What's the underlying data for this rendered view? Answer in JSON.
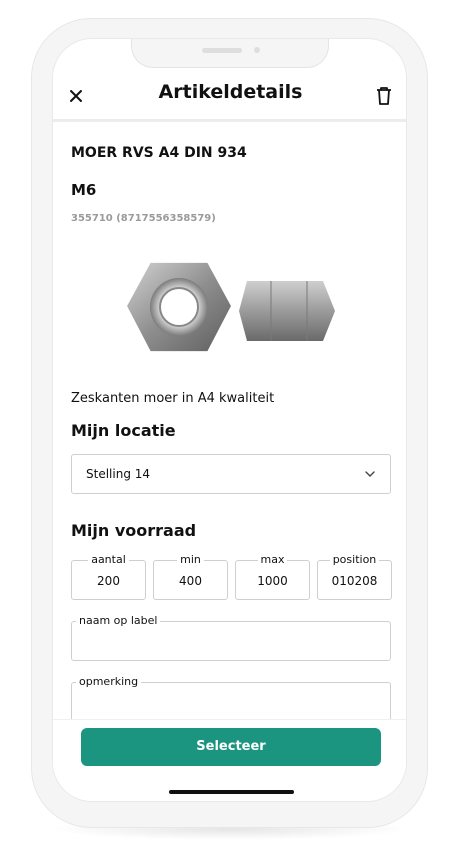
{
  "header": {
    "title": "Artikeldetails"
  },
  "product": {
    "name": "MOER RVS A4 DIN 934",
    "size": "M6",
    "code": "355710 (8717556358579)",
    "description": "Zeskanten moer in A4 kwaliteit"
  },
  "location": {
    "title": "Mijn locatie",
    "selected": "Stelling 14"
  },
  "stock": {
    "title": "Mijn voorraad",
    "fields": [
      {
        "label": "aantal",
        "value": "200"
      },
      {
        "label": "min",
        "value": "400"
      },
      {
        "label": "max",
        "value": "1000"
      },
      {
        "label": "position",
        "value": "010208"
      }
    ],
    "label_name": {
      "label": "naam op label",
      "value": ""
    },
    "remark": {
      "label": "opmerking",
      "value": ""
    }
  },
  "footer": {
    "select_label": "Selecteer"
  },
  "colors": {
    "accent": "#1c9580"
  },
  "icons": [
    "close-icon",
    "trash-icon",
    "chevron-down-icon"
  ]
}
